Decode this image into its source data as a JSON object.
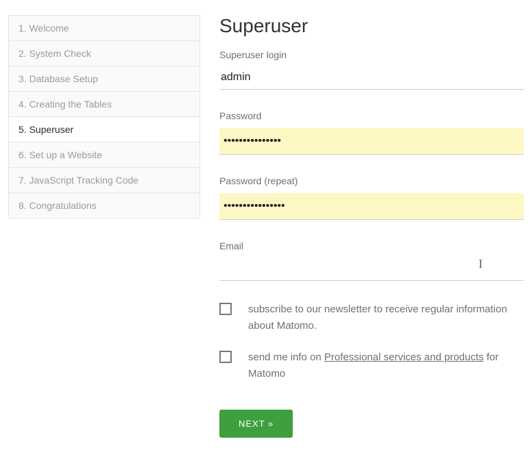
{
  "sidebar": {
    "items": [
      {
        "label": "1. Welcome",
        "active": false
      },
      {
        "label": "2. System Check",
        "active": false
      },
      {
        "label": "3. Database Setup",
        "active": false
      },
      {
        "label": "4. Creating the Tables",
        "active": false
      },
      {
        "label": "5. Superuser",
        "active": true
      },
      {
        "label": "6. Set up a Website",
        "active": false
      },
      {
        "label": "7. JavaScript Tracking Code",
        "active": false
      },
      {
        "label": "8. Congratulations",
        "active": false
      }
    ]
  },
  "main": {
    "title": "Superuser",
    "login_label": "Superuser login",
    "login_value": "admin",
    "password_label": "Password",
    "password_value": "•••••••••••••••",
    "password_repeat_label": "Password (repeat)",
    "password_repeat_value": "••••••••••••••••",
    "email_label": "Email",
    "email_value": "",
    "newsletter_checkbox_text": "subscribe to our newsletter to receive regular information about Matomo.",
    "pro_checkbox_prefix": "send me info on ",
    "pro_checkbox_link": "Professional services and products",
    "pro_checkbox_suffix": " for Matomo",
    "next_button": "NEXT »"
  }
}
